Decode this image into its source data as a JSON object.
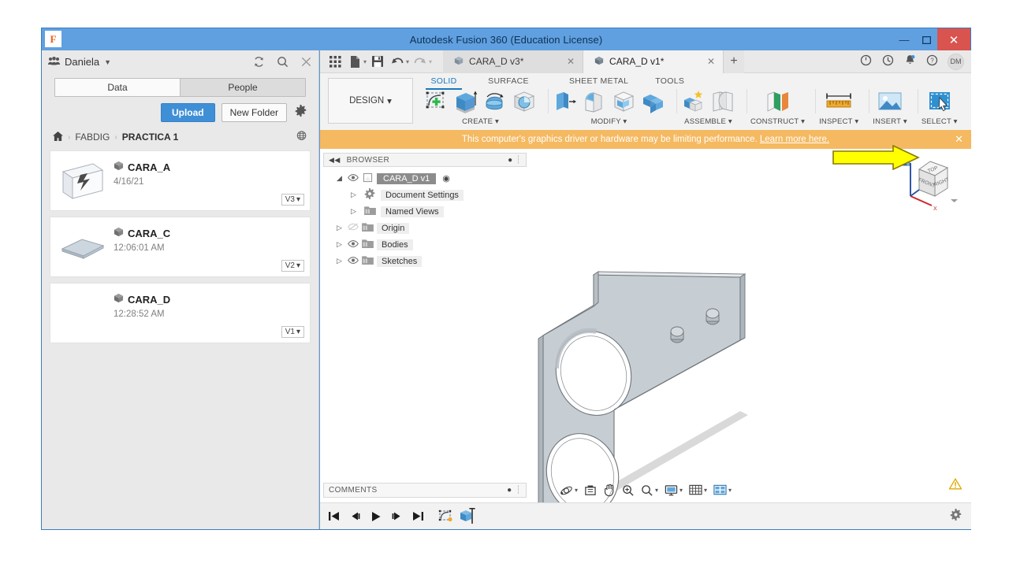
{
  "window": {
    "title": "Autodesk Fusion 360 (Education License)",
    "logo_letter": "F",
    "minimize": "—",
    "maximize": "❐",
    "close": "✕"
  },
  "data_panel": {
    "user_name": "Daniela",
    "user_caret": "▼",
    "icons": {
      "refresh": "refresh-icon",
      "search": "search-icon",
      "close": "close-icon"
    },
    "tabs": [
      {
        "label": "Data",
        "active": true
      },
      {
        "label": "People",
        "active": false
      }
    ],
    "upload_label": "Upload",
    "new_folder_label": "New Folder",
    "settings_icon": "gear-icon",
    "breadcrumb": {
      "home_icon": "home-icon",
      "separator": "›",
      "items": [
        "FABDIG",
        "PRACTICA 1"
      ],
      "globe_icon": "globe-icon"
    },
    "files": [
      {
        "name": "CARA_A",
        "date": "4/16/21",
        "version": "V3",
        "thumb": "sheet-metal-thumb"
      },
      {
        "name": "CARA_C",
        "date": "12:06:01 AM",
        "version": "V2",
        "thumb": "flat-plate-thumb"
      },
      {
        "name": "CARA_D",
        "date": "12:28:52 AM",
        "version": "V1",
        "thumb": "none"
      }
    ],
    "version_caret": "▾"
  },
  "quick_access": {
    "icons": [
      "grid-apps-icon",
      "new-file-icon",
      "save-icon",
      "undo-icon",
      "redo-icon"
    ],
    "document_tabs": [
      {
        "label": "CARA_D v3*",
        "active": false,
        "close": "✕"
      },
      {
        "label": "CARA_D v1*",
        "active": true,
        "close": "✕"
      }
    ],
    "add_tab": "+",
    "right_icons": [
      "job-status-icon",
      "recent-icon",
      "notifications-icon",
      "help-icon"
    ],
    "avatar_initials": "DM"
  },
  "ribbon": {
    "workspace_label": "DESIGN",
    "workspace_caret": "▾",
    "tabs": [
      {
        "label": "SOLID",
        "active": true
      },
      {
        "label": "SURFACE",
        "active": false
      },
      {
        "label": "SHEET METAL",
        "active": false
      },
      {
        "label": "TOOLS",
        "active": false
      }
    ],
    "groups": [
      {
        "label": "CREATE",
        "caret": "▾",
        "icons": [
          "create-sketch-icon",
          "extrude-icon",
          "revolve-icon",
          "hole-icon"
        ]
      },
      {
        "label": "MODIFY",
        "caret": "▾",
        "icons": [
          "press-pull-icon",
          "fillet-icon",
          "shell-icon",
          "combine-icon"
        ]
      },
      {
        "label": "ASSEMBLE",
        "caret": "▾",
        "icons": [
          "new-component-icon",
          "joint-icon"
        ]
      },
      {
        "label": "CONSTRUCT",
        "caret": "▾",
        "icons": [
          "offset-plane-icon"
        ]
      },
      {
        "label": "INSPECT",
        "caret": "▾",
        "icons": [
          "measure-icon"
        ]
      },
      {
        "label": "INSERT",
        "caret": "▾",
        "icons": [
          "insert-image-icon"
        ]
      },
      {
        "label": "SELECT",
        "caret": "▾",
        "icons": [
          "select-icon"
        ]
      }
    ]
  },
  "banner": {
    "message": "This computer's graphics driver or hardware may be limiting performance.",
    "link_text": "Learn more here.",
    "close": "✕",
    "background": "#f5b961"
  },
  "browser": {
    "title": "BROWSER",
    "collapse_icon": "collapse-left-icon",
    "nodes": [
      {
        "label": "CARA_D v1",
        "indent": 0,
        "root": true,
        "eye": "visible",
        "icon": "component-icon",
        "arrow": "◢",
        "radio": "◉"
      },
      {
        "label": "Document Settings",
        "indent": 1,
        "root": false,
        "eye": "none",
        "icon": "gear-icon",
        "arrow": "▷"
      },
      {
        "label": "Named Views",
        "indent": 1,
        "root": false,
        "eye": "none",
        "icon": "folder-icon",
        "arrow": "▷"
      },
      {
        "label": "Origin",
        "indent": 1,
        "root": false,
        "eye": "hidden",
        "icon": "folder-icon",
        "arrow": "▷"
      },
      {
        "label": "Bodies",
        "indent": 1,
        "root": false,
        "eye": "visible",
        "icon": "folder-icon",
        "arrow": "▷"
      },
      {
        "label": "Sketches",
        "indent": 1,
        "root": false,
        "eye": "visible",
        "icon": "folder-icon",
        "arrow": "▷"
      }
    ]
  },
  "comments": {
    "title": "COMMENTS",
    "add_icon": "add-comment-icon"
  },
  "navigation_bar": {
    "icons": [
      "orbit-icon",
      "look-at-icon",
      "pan-icon",
      "zoom-window-icon",
      "zoom-icon",
      "display-settings-icon",
      "grid-snaps-icon",
      "viewports-icon"
    ],
    "caret": "▾"
  },
  "timeline": {
    "buttons": [
      "go-to-beginning-icon",
      "step-back-icon",
      "play-icon",
      "step-forward-icon",
      "go-to-end-icon",
      "sketch-feature-icon",
      "extrude-feature-icon"
    ],
    "settings_icon": "gear-icon"
  },
  "status": {
    "warning_icon": "warning-triangle-icon"
  },
  "viewcube": {
    "home_icon": "home-icon",
    "faces": {
      "top": "TOP",
      "front": "FRONT",
      "right": "RIGHT"
    },
    "axis_label": "X",
    "menu_caret": "▾"
  },
  "annotation": {
    "arrow_color": "#ffff00",
    "arrow_outline": "#8a7a00",
    "target": "viewcube-home"
  },
  "model": {
    "name": "CARA_D",
    "description": "L-shaped sheet metal bracket with two large circular holes and two small bosses"
  }
}
